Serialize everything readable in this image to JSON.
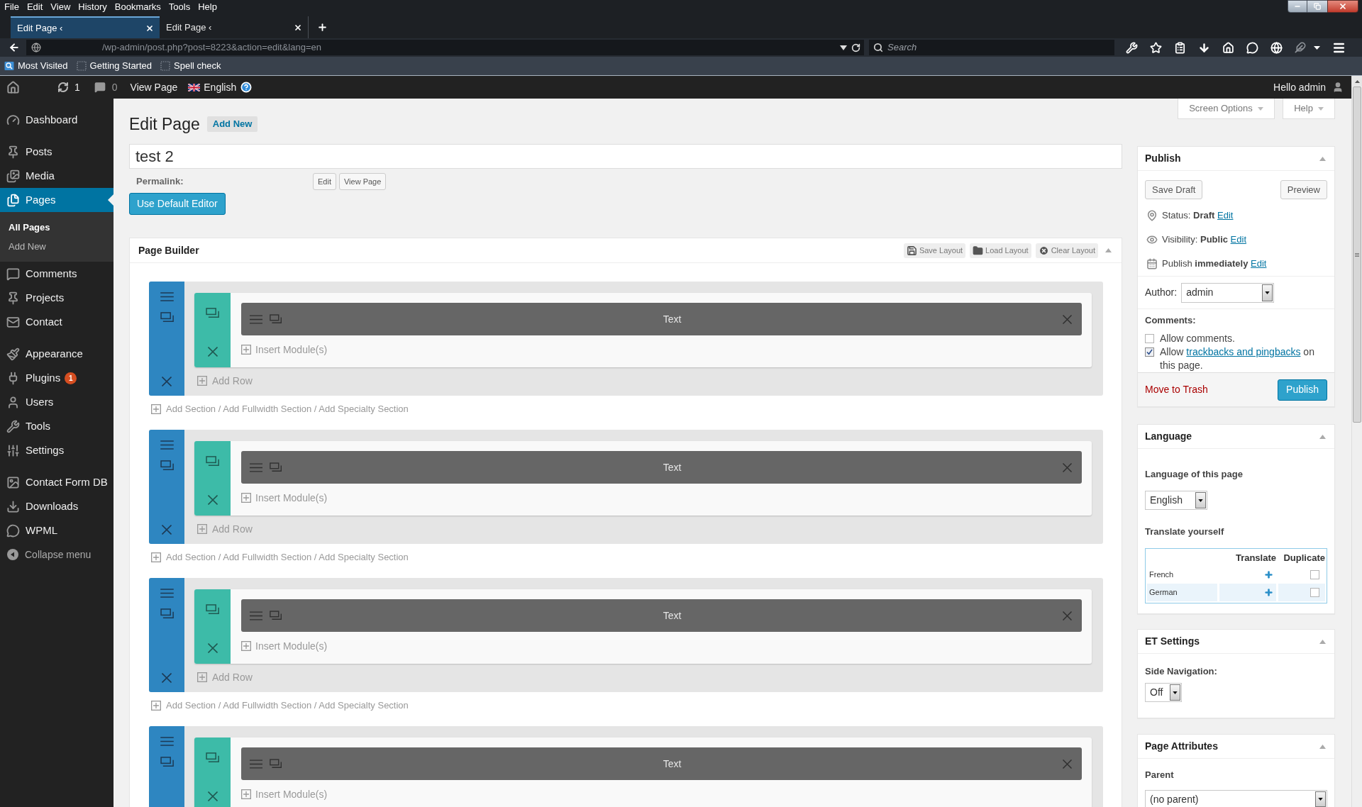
{
  "browser": {
    "menu": [
      "File",
      "Edit",
      "View",
      "History",
      "Bookmarks",
      "Tools",
      "Help"
    ],
    "tabs": [
      {
        "title": "Edit Page ‹",
        "selected": true
      },
      {
        "title": "Edit Page ‹",
        "selected": false
      }
    ],
    "address": "/wp-admin/post.php?post=8223&action=edit&lang=en",
    "search": {
      "placeholder": "Search"
    },
    "bookmarks": [
      "Most Visited",
      "Getting Started",
      "Spell check"
    ]
  },
  "admin_bar": {
    "updates": "1",
    "comments": "0",
    "view_page": "View Page",
    "language": "English",
    "greeting": "Hello admin"
  },
  "sidebar": {
    "groups": [
      [
        {
          "label": "Dashboard",
          "selected": false
        }
      ],
      [
        {
          "label": "Posts",
          "selected": false
        },
        {
          "label": "Media",
          "selected": false
        },
        {
          "label": "Pages",
          "selected": true,
          "children": [
            {
              "label": "All Pages",
              "selected": true
            },
            {
              "label": "Add New",
              "selected": false
            }
          ]
        },
        {
          "label": "Comments",
          "selected": false
        },
        {
          "label": "Projects",
          "selected": false
        },
        {
          "label": "Contact",
          "selected": false
        }
      ],
      [
        {
          "label": "Appearance",
          "selected": false
        },
        {
          "label": "Plugins",
          "selected": false,
          "badge": "1"
        },
        {
          "label": "Users",
          "selected": false
        },
        {
          "label": "Tools",
          "selected": false
        },
        {
          "label": "Settings",
          "selected": false
        }
      ],
      [
        {
          "label": "Contact Form DB",
          "selected": false
        },
        {
          "label": "Downloads",
          "selected": false
        },
        {
          "label": "WPML",
          "selected": false
        }
      ]
    ],
    "collapse": "Collapse menu"
  },
  "header": {
    "title": "Edit Page",
    "add_new": "Add New",
    "screen_options": "Screen Options",
    "help": "Help"
  },
  "editor": {
    "title_field": {
      "value": "test 2"
    },
    "permalink": {
      "label": "Permalink:",
      "buttons": [
        "Edit",
        "View Page"
      ]
    },
    "default_editor": "Use Default Editor"
  },
  "page_builder": {
    "title": "Page Builder",
    "actions": [
      "Save Layout",
      "Load Layout",
      "Clear Layout"
    ],
    "sections": [
      {
        "module": "Text",
        "insert": "Insert Module(s)",
        "add_row": "Add Row",
        "add_section": "Add Section / Add Fullwidth Section / Add Specialty Section"
      },
      {
        "module": "Text",
        "insert": "Insert Module(s)",
        "add_row": "Add Row",
        "add_section": "Add Section / Add Fullwidth Section / Add Specialty Section"
      },
      {
        "module": "Text",
        "insert": "Insert Module(s)",
        "add_row": "Add Row",
        "add_section": "Add Section / Add Fullwidth Section / Add Specialty Section"
      },
      {
        "module": "Text",
        "insert": "Insert Module(s)"
      }
    ]
  },
  "publish": {
    "title": "Publish",
    "save_draft": "Save Draft",
    "preview": "Preview",
    "details": [
      {
        "label": "Status:",
        "value": "Draft",
        "link": "Edit"
      },
      {
        "label": "Visibility:",
        "value": "Public",
        "link": "Edit"
      },
      {
        "label": "Publish",
        "value": "immediately",
        "link": "Edit"
      }
    ],
    "author": {
      "label": "Author:",
      "value": "admin"
    },
    "comments": {
      "title": "Comments:",
      "options": [
        {
          "text": "Allow comments.",
          "checked": false
        },
        {
          "text": "Allow",
          "link": "trackbacks and pingbacks",
          "text_after": "on this page.",
          "checked": true
        }
      ]
    },
    "trash": "Move to Trash",
    "publish_button": "Publish"
  },
  "language": {
    "title": "Language",
    "page_language": {
      "label": "Language of this page",
      "value": "English"
    },
    "translate": {
      "title": "Translate yourself",
      "columns": [
        "Translate",
        "Duplicate"
      ],
      "rows": [
        {
          "language": "French",
          "duplicate": false
        },
        {
          "language": "German",
          "duplicate": false
        }
      ]
    }
  },
  "et_settings": {
    "title": "ET Settings",
    "side_navigation": {
      "label": "Side Navigation:",
      "value": "Off"
    }
  },
  "page_attributes": {
    "title": "Page Attributes",
    "parent": {
      "label": "Parent",
      "value": "(no parent)"
    }
  }
}
